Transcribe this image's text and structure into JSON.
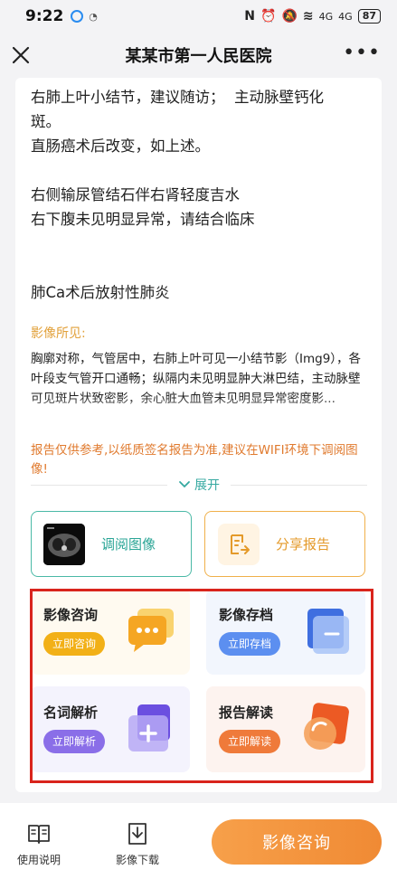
{
  "status_bar": {
    "time": "9:22",
    "right": {
      "nfc": "N",
      "signal_1": "4G",
      "signal_2": "4G",
      "battery": "87"
    }
  },
  "nav": {
    "title": "某某市第一人民医院",
    "more": "•••"
  },
  "report": {
    "conclusion_lines": [
      "右肺上叶小结节，建议随访；  主动脉壁钙化",
      "斑。",
      "直肠癌术后改变，如上述。",
      "",
      "右侧输尿管结石伴右肾轻度吉水",
      "右下腹未见明显异常，请结合临床",
      "",
      "",
      "肺Ca术后放射性肺炎"
    ],
    "findings_label": "影像所见:",
    "findings_text": "胸廓对称，气管居中，右肺上叶可见一小结节影（Img9），各叶段支气管开口通畅；纵隔内未见明显肿大淋巴结，主动脉壁可见斑片状致密影，余心脏大血管未见明显异常密度影...",
    "warning": "报告仅供参考,以纸质签名报告为准,建议在WIFI环境下调阅图像!",
    "expand_label": "展开"
  },
  "actions": {
    "view_images": "调阅图像",
    "share_report": "分享报告"
  },
  "services": [
    {
      "title": "影像咨询",
      "button": "立即咨询",
      "icon": "chat-bubble-icon",
      "color": "#f2b017"
    },
    {
      "title": "影像存档",
      "button": "立即存档",
      "icon": "folder-icon",
      "color": "#5c8ff0"
    },
    {
      "title": "名词解析",
      "button": "立即解析",
      "icon": "plus-card-icon",
      "color": "#8a6ee8"
    },
    {
      "title": "报告解读",
      "button": "立即解读",
      "icon": "magnifier-icon",
      "color": "#ef7a3a"
    }
  ],
  "bottom_bar": {
    "manual": "使用说明",
    "download": "影像下载",
    "primary": "影像咨询"
  }
}
